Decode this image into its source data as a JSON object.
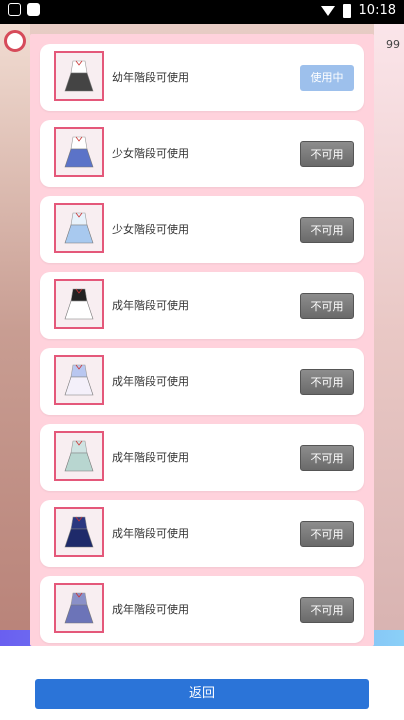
{
  "status": {
    "time": "10:18"
  },
  "background": {
    "number": "99"
  },
  "outfits": [
    {
      "stage": "幼年階段可使用",
      "button": "使用中",
      "state": "in-use",
      "skirt_color": "#444444",
      "top_color": "#ffffff"
    },
    {
      "stage": "少女階段可使用",
      "button": "不可用",
      "state": "unavailable",
      "skirt_color": "#5b73c8",
      "top_color": "#ffffff"
    },
    {
      "stage": "少女階段可使用",
      "button": "不可用",
      "state": "unavailable",
      "skirt_color": "#a8c9ef",
      "top_color": "#e8f2fb"
    },
    {
      "stage": "成年階段可使用",
      "button": "不可用",
      "state": "unavailable",
      "skirt_color": "#ffffff",
      "top_color": "#222222"
    },
    {
      "stage": "成年階段可使用",
      "button": "不可用",
      "state": "unavailable",
      "skirt_color": "#f4f0fa",
      "top_color": "#b9c7f0"
    },
    {
      "stage": "成年階段可使用",
      "button": "不可用",
      "state": "unavailable",
      "skirt_color": "#b8d6d0",
      "top_color": "#cfe3e2"
    },
    {
      "stage": "成年階段可使用",
      "button": "不可用",
      "state": "unavailable",
      "skirt_color": "#1e2a6a",
      "top_color": "#2a3780"
    },
    {
      "stage": "成年階段可使用",
      "button": "不可用",
      "state": "unavailable",
      "skirt_color": "#6c74b8",
      "top_color": "#8a90c8"
    }
  ],
  "footer": {
    "back_label": "返回"
  }
}
